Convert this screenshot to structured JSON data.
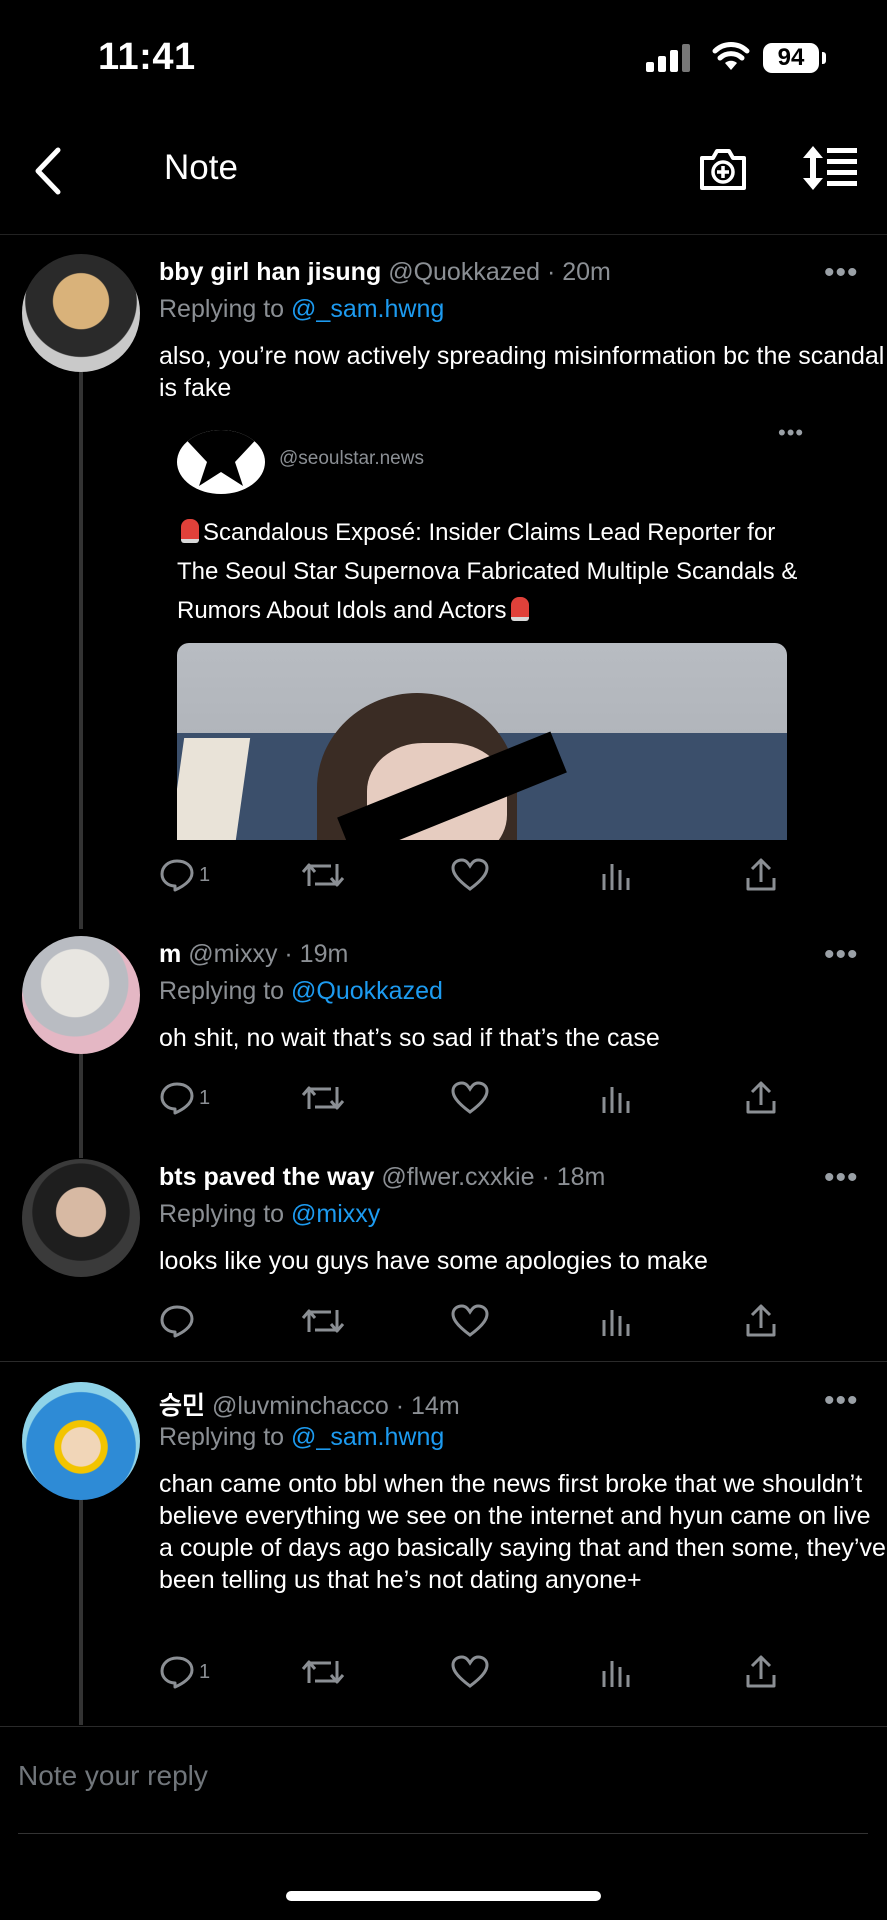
{
  "status_bar": {
    "time": "11:41",
    "battery": "94"
  },
  "nav": {
    "title": "Note",
    "back_icon": "chevron-left-icon",
    "camera_icon": "camera-plus-icon",
    "sort_icon": "sort-icon"
  },
  "tweets": [
    {
      "name": "bby girl han jisung",
      "handle": "@Quokkazed · 20m",
      "replying_label": "Replying to ",
      "replying_to": "@_sam.hwng",
      "text": "also, you’re now actively spreading misinformation bc the scandal is fake",
      "quote": {
        "handle": "@seoulstar.news",
        "text": "Scandalous Exposé: Insider Claims Lead Reporter for The Seoul Star Supernova Fabricated  Multiple Scandals & Rumors About Idols and Actors"
      },
      "reply_count": "1"
    },
    {
      "name": "m",
      "handle": "@mixxy · 19m",
      "replying_label": "Replying to ",
      "replying_to": "@Quokkazed",
      "text": "oh shit, no wait that’s so sad if that’s the case",
      "reply_count": "1"
    },
    {
      "name": "bts paved the way",
      "handle": "@flwer.cxxkie · 18m",
      "replying_label": "Replying to ",
      "replying_to": "@mixxy",
      "text": "looks like you guys have some apologies to make",
      "reply_count": ""
    },
    {
      "name": "승민",
      "handle": "@luvminchacco · 14m",
      "replying_label": "Replying to ",
      "replying_to": "@_sam.hwng",
      "text": "chan came onto bbl when the news first broke that we shouldn’t believe everything we see on the internet and hyun came on live a couple of days ago basically saying that and then some, they’ve been telling us that he’s not dating anyone+",
      "reply_count": "1"
    }
  ],
  "more_label": "•••",
  "reply_bar": {
    "placeholder": "Note your reply"
  },
  "colors": {
    "background": "#000000",
    "link": "#1d9bf0",
    "muted": "#8b8f94"
  }
}
